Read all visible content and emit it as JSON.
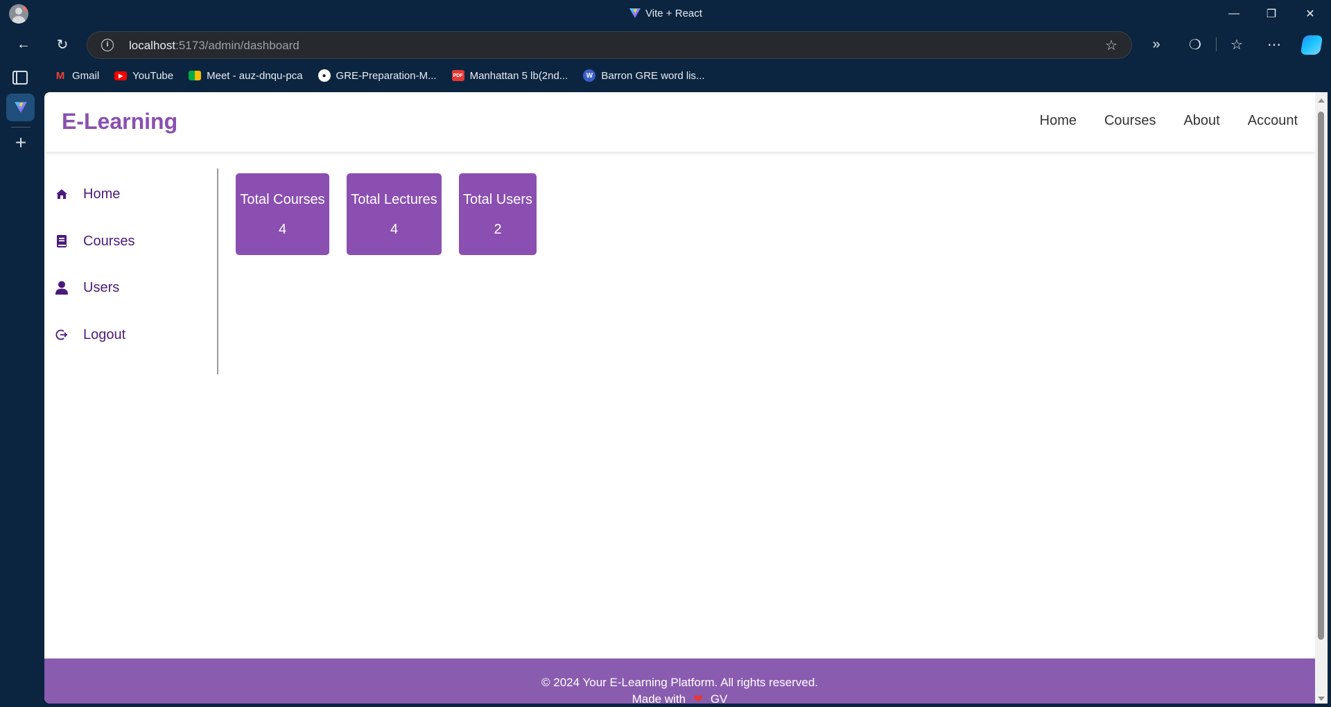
{
  "browser": {
    "window_title": "Vite + React",
    "url_host": "localhost",
    "url_path": ":5173/admin/dashboard",
    "bookmarks": [
      {
        "label": "Gmail",
        "icon": "gmail-icon",
        "color": "#ea4335"
      },
      {
        "label": "YouTube",
        "icon": "youtube-icon",
        "color": "#ff0000"
      },
      {
        "label": "Meet - auz-dnqu-pca",
        "icon": "meet-icon",
        "color": "#00ac47"
      },
      {
        "label": "GRE-Preparation-M...",
        "icon": "github-icon",
        "color": "#ffffff"
      },
      {
        "label": "Manhattan 5 lb(2nd...",
        "icon": "pdf-icon",
        "color": "#e53935"
      },
      {
        "label": "Barron GRE word lis...",
        "icon": "wordpress-icon",
        "color": "#3c5ec9"
      }
    ]
  },
  "site": {
    "logo": "E-Learning",
    "nav": [
      "Home",
      "Courses",
      "About",
      "Account"
    ],
    "accent_color": "#8a4fb0"
  },
  "sidebar": {
    "items": [
      {
        "label": "Home",
        "icon": "home-icon"
      },
      {
        "label": "Courses",
        "icon": "book-icon"
      },
      {
        "label": "Users",
        "icon": "user-icon"
      },
      {
        "label": "Logout",
        "icon": "logout-icon"
      }
    ]
  },
  "stats": [
    {
      "title": "Total Courses",
      "value": "4"
    },
    {
      "title": "Total Lectures",
      "value": "4"
    },
    {
      "title": "Total Users",
      "value": "2"
    }
  ],
  "footer": {
    "copyright": "© 2024 Your E-Learning Platform. All rights reserved.",
    "made_with_prefix": "Made with",
    "made_with_suffix": "GV",
    "heart_icon": "heart-icon"
  }
}
